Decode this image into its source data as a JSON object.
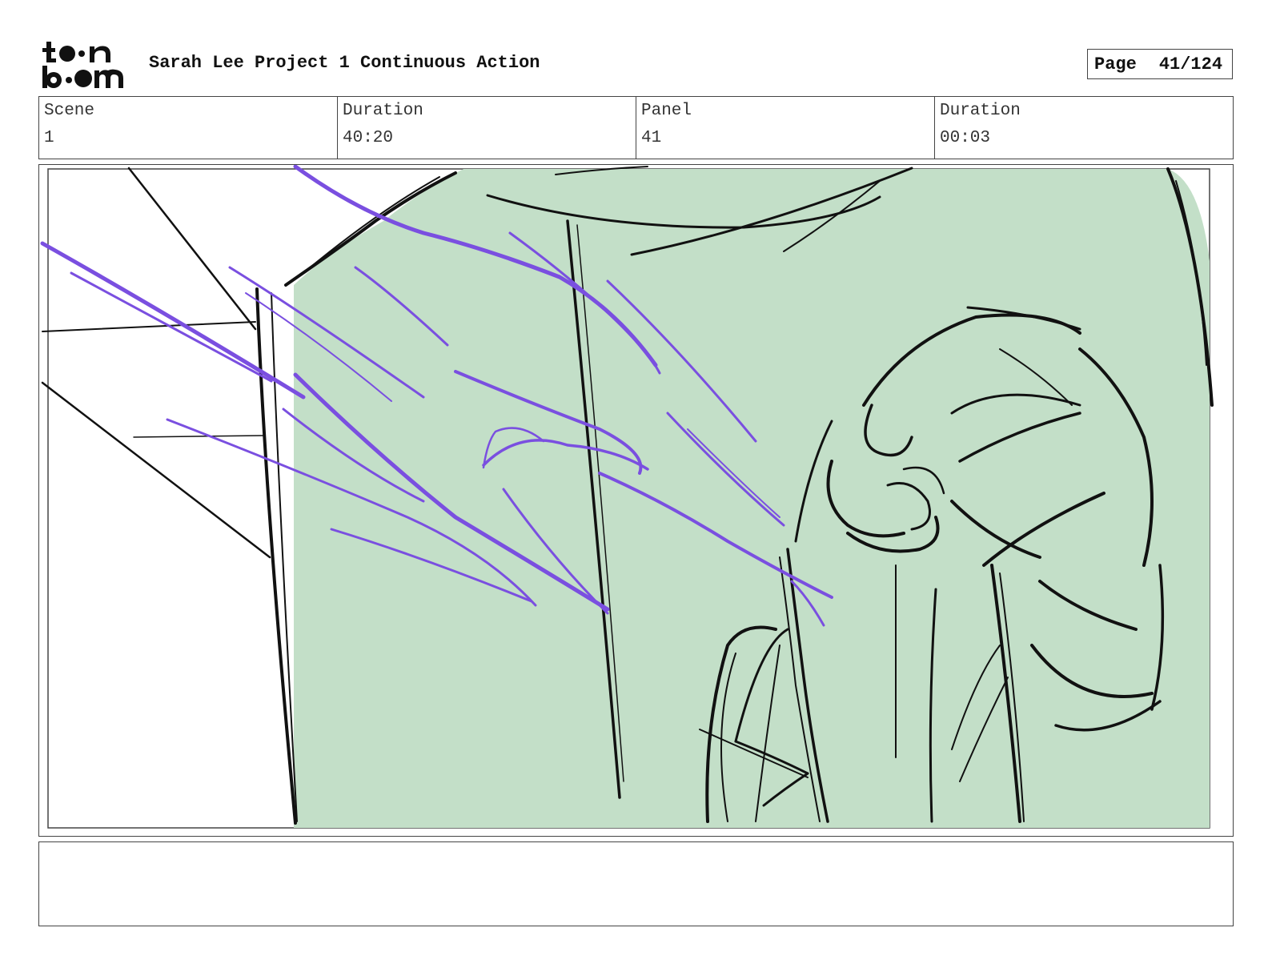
{
  "header": {
    "logo_text": "toonboom",
    "project_title": "Sarah Lee Project 1 Continuous Action",
    "page_label": "Page",
    "page_number": "41/124"
  },
  "info": {
    "scene_label": "Scene",
    "scene_value": "1",
    "scene_duration_label": "Duration",
    "scene_duration_value": "40:20",
    "panel_label": "Panel",
    "panel_value": "41",
    "panel_duration_label": "Duration",
    "panel_duration_value": "00:03"
  },
  "panel": {
    "fill_color": "#c3dfc8",
    "line_color": "#111111",
    "motion_color": "#7a4fe0"
  },
  "notes": {
    "text": ""
  }
}
